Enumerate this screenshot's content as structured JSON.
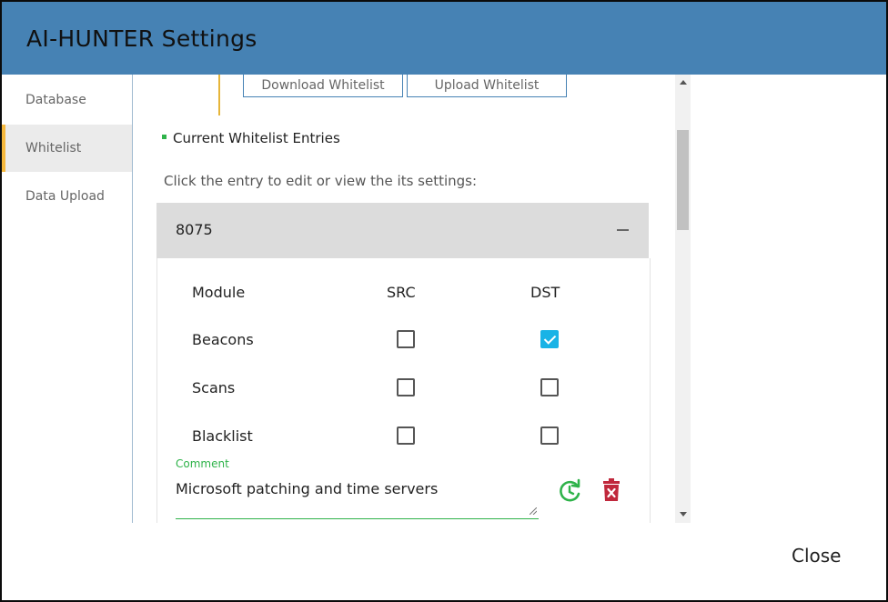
{
  "dialog": {
    "title": "AI-HUNTER Settings",
    "close_label": "Close"
  },
  "sidebar": {
    "items": [
      {
        "label": "Database",
        "active": false
      },
      {
        "label": "Whitelist",
        "active": true
      },
      {
        "label": "Data Upload",
        "active": false
      }
    ]
  },
  "whitelist": {
    "download_label": "Download Whitelist",
    "upload_label": "Upload Whitelist",
    "section_title": "Current Whitelist Entries",
    "hint": "Click the entry to edit or view the its settings:",
    "entry": {
      "name": "8075",
      "columns": [
        "Module",
        "SRC",
        "DST"
      ],
      "rows": [
        {
          "module": "Beacons",
          "src": false,
          "dst": true
        },
        {
          "module": "Scans",
          "src": false,
          "dst": false
        },
        {
          "module": "Blacklist",
          "src": false,
          "dst": false
        }
      ],
      "comment_label": "Comment",
      "comment": "Microsoft patching and time servers"
    }
  },
  "colors": {
    "header": "#4682b4",
    "accent_green": "#2fb34a",
    "checkbox_checked": "#19b3e6",
    "delete_red": "#c0283c",
    "active_marker": "#f5b83d"
  },
  "icons": [
    "minus-icon",
    "checkmark-icon",
    "refresh-icon",
    "trash-icon",
    "scroll-up-arrow-icon",
    "scroll-down-arrow-icon"
  ]
}
